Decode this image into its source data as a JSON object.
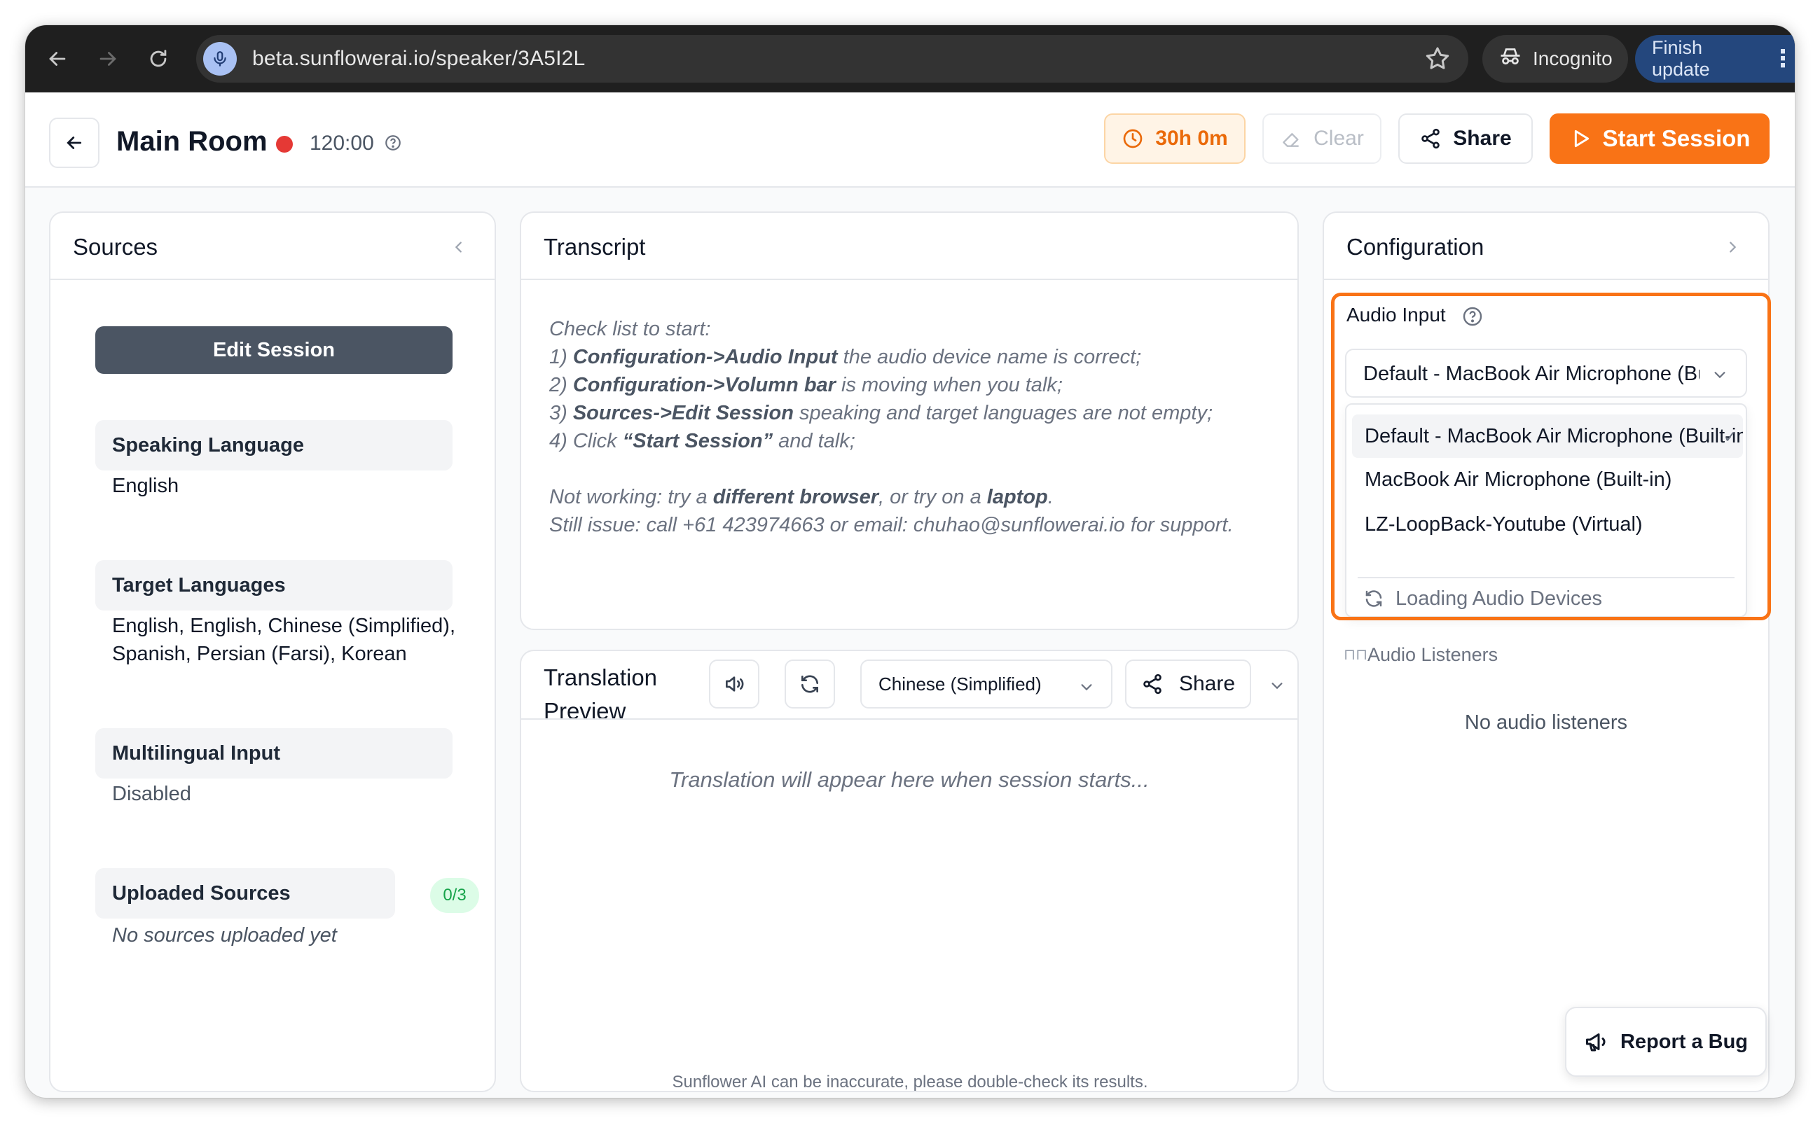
{
  "browser": {
    "url": "beta.sunflowerai.io/speaker/3A5I2L",
    "incognito_label": "Incognito",
    "finish_update_label": "Finish update"
  },
  "header": {
    "room_title": "Main Room",
    "timer": "120:00",
    "time_remaining": "30h 0m",
    "clear_label": "Clear",
    "share_label": "Share",
    "start_label": "Start Session",
    "accent_color": "#f97316",
    "live_dot_color": "#e53935"
  },
  "sources": {
    "title": "Sources",
    "edit_session_label": "Edit Session",
    "speaking_language_label": "Speaking Language",
    "speaking_language_value": "English",
    "target_languages_label": "Target Languages",
    "target_languages_line1": "English, English, Chinese (Simplified),",
    "target_languages_line2": "Spanish, Persian (Farsi), Korean",
    "multilingual_label": "Multilingual Input",
    "multilingual_value": "Disabled",
    "uploaded_label": "Uploaded Sources",
    "uploaded_count": "0/3",
    "uploaded_empty": "No sources uploaded yet"
  },
  "transcript": {
    "title": "Transcript",
    "checklist_intro": "Check list to start:",
    "step1_num": "1) ",
    "step1_bold": "Configuration->Audio Input",
    "step1_rest": " the audio device name is correct;",
    "step2_num": "2) ",
    "step2_bold": "Configuration->Volumn bar",
    "step2_rest": " is moving when you talk;",
    "step3_num": "3) ",
    "step3_bold": "Sources->Edit Session",
    "step3_rest": " speaking and target languages are not empty;",
    "step4_num": "4) Click ",
    "step4_bold": "“Start Session”",
    "step4_rest": " and talk;",
    "help1_a": "Not working: try a ",
    "help1_bold1": "different browser",
    "help1_b": ", or try on a ",
    "help1_bold2": "laptop",
    "help1_c": ".",
    "help2": "Still issue: call +61 423974663 or email: chuhao@sunflowerai.io for support."
  },
  "translation": {
    "title": "Translation Preview",
    "language": "Chinese (Simplified)",
    "share_label": "Share",
    "placeholder": "Translation will appear here when session starts..."
  },
  "configuration": {
    "title": "Configuration",
    "audio_input_label": "Audio Input",
    "selected_device": "Default - MacBook Air Microphone (Built-in)",
    "options": [
      "Default - MacBook Air Microphone (Built-in)",
      "MacBook Air Microphone (Built-in)",
      "LZ-LoopBack-Youtube (Virtual)"
    ],
    "loading_label": "Loading Audio Devices",
    "audio_listeners_label": "Audio Listeners",
    "no_listeners": "No audio listeners"
  },
  "report_bug_label": "Report a Bug",
  "footer_note": "Sunflower AI can be inaccurate, please double-check its results."
}
